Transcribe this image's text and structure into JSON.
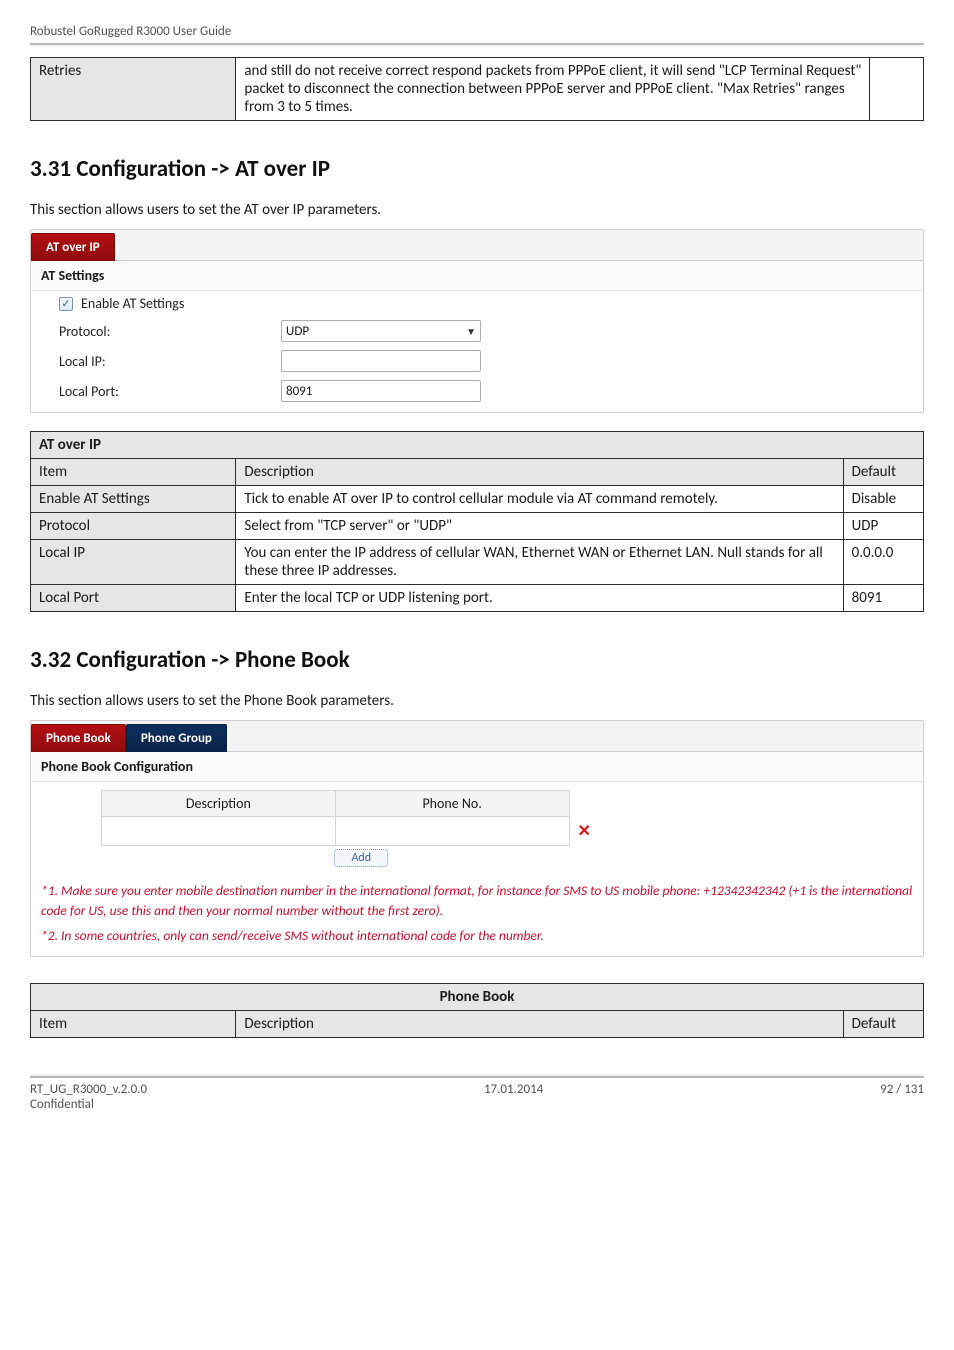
{
  "header": {
    "doc_title": "Robustel GoRugged R3000 User Guide"
  },
  "retries_table": {
    "row_label": "Retries",
    "row_text": "and still do not receive correct respond packets from PPPoE client, it will send \"LCP Terminal Request\" packet to disconnect the connection between PPPoE server and PPPoE client. \"Max Retries\" ranges from 3 to 5 times."
  },
  "section_at": {
    "heading": "3.31  Configuration -> AT over IP",
    "intro": "This section allows users to set the AT over IP parameters.",
    "tab_label": "AT over IP",
    "group_heading": "AT Settings",
    "enable_label": "Enable AT Settings",
    "enable_checked": true,
    "rows": {
      "protocol_label": "Protocol:",
      "protocol_value": "UDP",
      "localip_label": "Local IP:",
      "localip_value": "",
      "localport_label": "Local Port:",
      "localport_value": "8091"
    }
  },
  "at_table": {
    "title": "AT over IP",
    "head_item": "Item",
    "head_desc": "Description",
    "head_default": "Default",
    "rows": [
      {
        "item": "Enable AT Settings",
        "desc": "Tick to enable AT over IP to control cellular module via AT command remotely.",
        "def": "Disable"
      },
      {
        "item": "Protocol",
        "desc": "Select from \"TCP server\" or \"UDP\"",
        "def": "UDP"
      },
      {
        "item": "Local IP",
        "desc": "You can enter the IP address of cellular WAN, Ethernet WAN or Ethernet LAN. Null stands for all these three IP addresses.",
        "def": "0.0.0.0"
      },
      {
        "item": "Local Port",
        "desc": "Enter the local TCP or UDP listening port.",
        "def": "8091"
      }
    ]
  },
  "section_pb": {
    "heading": "3.32  Configuration -> Phone Book",
    "intro": "This section allows users to set the Phone Book parameters.",
    "tab_active": "Phone Book",
    "tab_inactive": "Phone Group",
    "group_heading": "Phone Book Configuration",
    "col_desc": "Description",
    "col_phone": "Phone No.",
    "add_label": "Add",
    "note1": "*1. Make sure you enter mobile destination number in the international format, for instance for SMS to US mobile phone: +12342342342 (+1 is the international code for US, use this and then your normal number without the first zero).",
    "note2": "*2. In some countries, only can send/receive SMS without international code for the number."
  },
  "pb_table": {
    "title": "Phone Book",
    "head_item": "Item",
    "head_desc": "Description",
    "head_default": "Default"
  },
  "footer": {
    "left1": "RT_UG_R3000_v.2.0.0",
    "left2": "Confidential",
    "center": "17.01.2014",
    "right": "92 / 131"
  }
}
